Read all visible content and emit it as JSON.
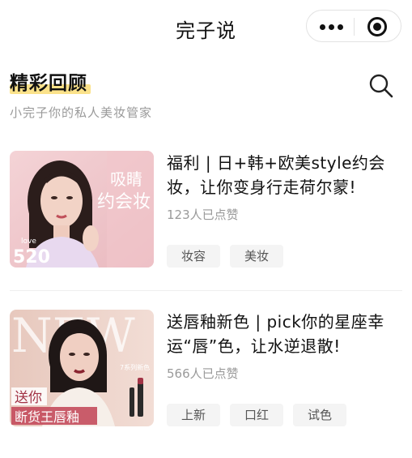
{
  "header": {
    "title": "完子说"
  },
  "section": {
    "title": "精彩回顾",
    "subtitle": "小完子你的私人美妆管家"
  },
  "articles": [
    {
      "title": "福利 | 日+韩+欧美style约会妆，让你变身行走荷尔蒙!",
      "likes": "123人已点赞",
      "tags": [
        "妆容",
        "美妆"
      ],
      "thumb_text": {
        "headline_1": "吸睛",
        "headline_2": "约会妆",
        "badge_top": "love",
        "badge_num": "520"
      }
    },
    {
      "title": "送唇釉新色 | pick你的星座幸运“唇”色，让水逆退散!",
      "likes": "566人已点赞",
      "tags": [
        "上新",
        "口红",
        "试色"
      ],
      "thumb_text": {
        "word": "NEW",
        "series": "7系列新色",
        "promo_1": "送你",
        "promo_2": "断货王唇釉"
      }
    }
  ],
  "colors": {
    "highlight": "#fbe28a",
    "tag_bg": "#f4f4f4",
    "muted_text": "#9a9a9a"
  }
}
